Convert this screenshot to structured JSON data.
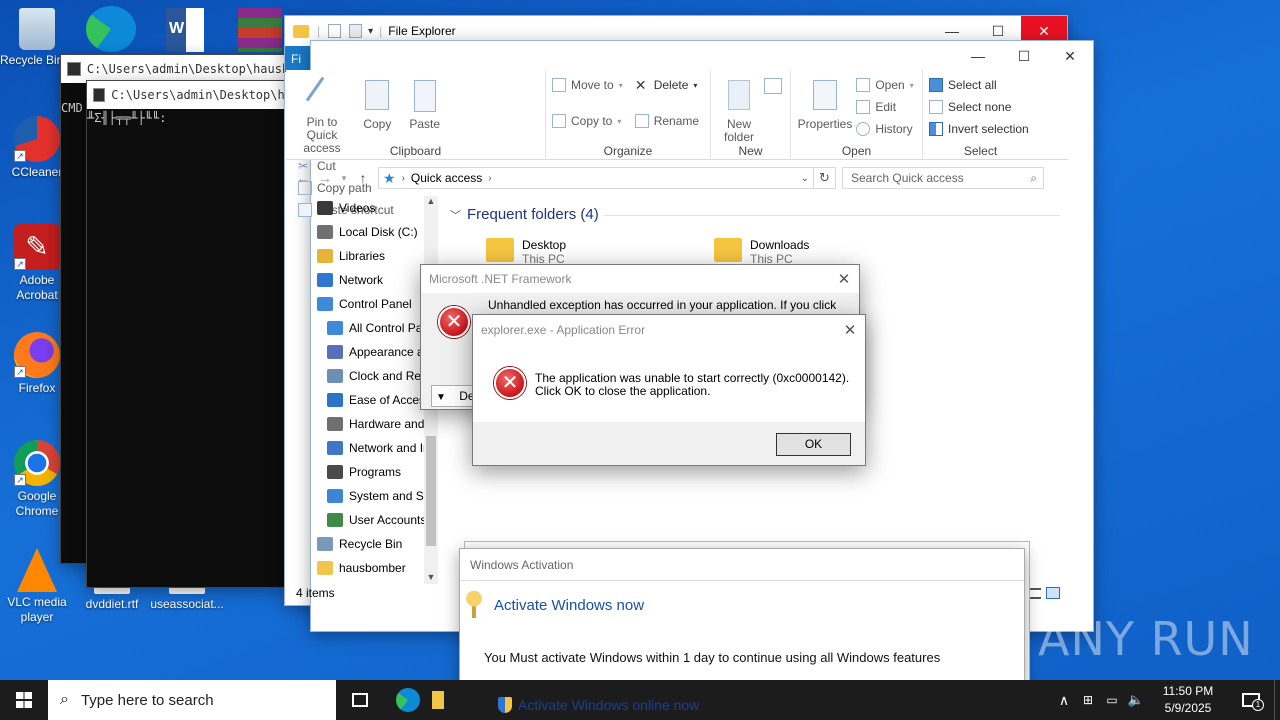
{
  "desktop": {
    "icons": [
      {
        "label": "Recycle Bin",
        "icon": "recycle-bin-icon"
      },
      {
        "label": "CCleaner",
        "icon": "ccleaner-icon"
      },
      {
        "label": "Adobe Acrobat",
        "icon": "acrobat-icon"
      },
      {
        "label": "Firefox",
        "icon": "firefox-icon"
      },
      {
        "label": "Google Chrome",
        "icon": "chrome-icon"
      },
      {
        "label": "VLC media player",
        "icon": "vlc-icon"
      },
      {
        "label": "dvddiet.rtf",
        "icon": "rtf-file-icon"
      },
      {
        "label": "useassociat...",
        "icon": "file-icon"
      }
    ]
  },
  "console_back": {
    "title": "C:\\Users\\admin\\Desktop\\hausbomb"
  },
  "console_front": {
    "title": "C:\\Users\\admin\\Desktop\\hausb",
    "prefix": "CMD",
    "line": "╨Σ╢├╤╤╨├╙╙:"
  },
  "explorer_back": {
    "title": "File Explorer",
    "tab": "Fi"
  },
  "explorer": {
    "ribbon": {
      "clipboard": {
        "name": "Clipboard",
        "pin": "Pin to Quick access",
        "copy": "Copy",
        "paste": "Paste",
        "cut": "Cut",
        "copy_path": "Copy path",
        "paste_shortcut": "Paste shortcut"
      },
      "organize": {
        "name": "Organize",
        "move_to": "Move to",
        "copy_to": "Copy to",
        "delete": "Delete",
        "rename": "Rename"
      },
      "new": {
        "name": "New",
        "new_folder": "New folder"
      },
      "open": {
        "name": "Open",
        "properties": "Properties",
        "open": "Open",
        "edit": "Edit",
        "history": "History"
      },
      "select": {
        "name": "Select",
        "select_all": "Select all",
        "select_none": "Select none",
        "invert": "Invert selection"
      }
    },
    "address": {
      "path": "Quick access",
      "search_placeholder": "Search Quick access"
    },
    "nav_items": [
      {
        "label": "Videos",
        "color": "#3a3a3a"
      },
      {
        "label": "Local Disk (C:)",
        "color": "#707070"
      },
      {
        "label": "Libraries",
        "color": "#e5b43a"
      },
      {
        "label": "Network",
        "color": "#2f77d0"
      },
      {
        "label": "Control Panel",
        "color": "#3c8ad8"
      },
      {
        "label": "All Control Par",
        "color": "#3c8ad8"
      },
      {
        "label": "Appearance ar",
        "color": "#5a6fb8"
      },
      {
        "label": "Clock and Reg",
        "color": "#6d8fb6"
      },
      {
        "label": "Ease of Access",
        "color": "#2c74c8"
      },
      {
        "label": "Hardware and",
        "color": "#6f6f6f"
      },
      {
        "label": "Network and Ir",
        "color": "#3f77c4"
      },
      {
        "label": "Programs",
        "color": "#4a4a4a"
      },
      {
        "label": "System and Sec",
        "color": "#3d86d4"
      },
      {
        "label": "User Accounts",
        "color": "#3f8a47"
      },
      {
        "label": "Recycle Bin",
        "color": "#7c98b8"
      },
      {
        "label": "hausbomber",
        "color": "#f0c64c"
      }
    ],
    "frequent_header": "Frequent folders (4)",
    "folders": [
      {
        "name": "Desktop",
        "sub": "This PC"
      },
      {
        "name": "Downloads",
        "sub": "This PC"
      }
    ],
    "status": "4 items"
  },
  "netfx_dialog": {
    "title": "Microsoft .NET Framework",
    "text": "Unhandled exception has occurred in your application. If you click",
    "details_label": "De"
  },
  "app_error": {
    "title": "explorer.exe - Application Error",
    "line1": "The application was unable to start correctly (0xc0000142).",
    "line2": "Click OK to close the application.",
    "ok": "OK"
  },
  "activation": {
    "title": "Windows Activation",
    "heading": "Activate Windows now",
    "message": "You Must activate Windows within 1 day to continue using all Windows features",
    "online": "Activate Windows online now"
  },
  "taskbar": {
    "search_placeholder": "Type here to search",
    "time": "11:50 PM",
    "date": "5/9/2025",
    "notification_count": "1"
  },
  "watermark": "ANY RUN"
}
